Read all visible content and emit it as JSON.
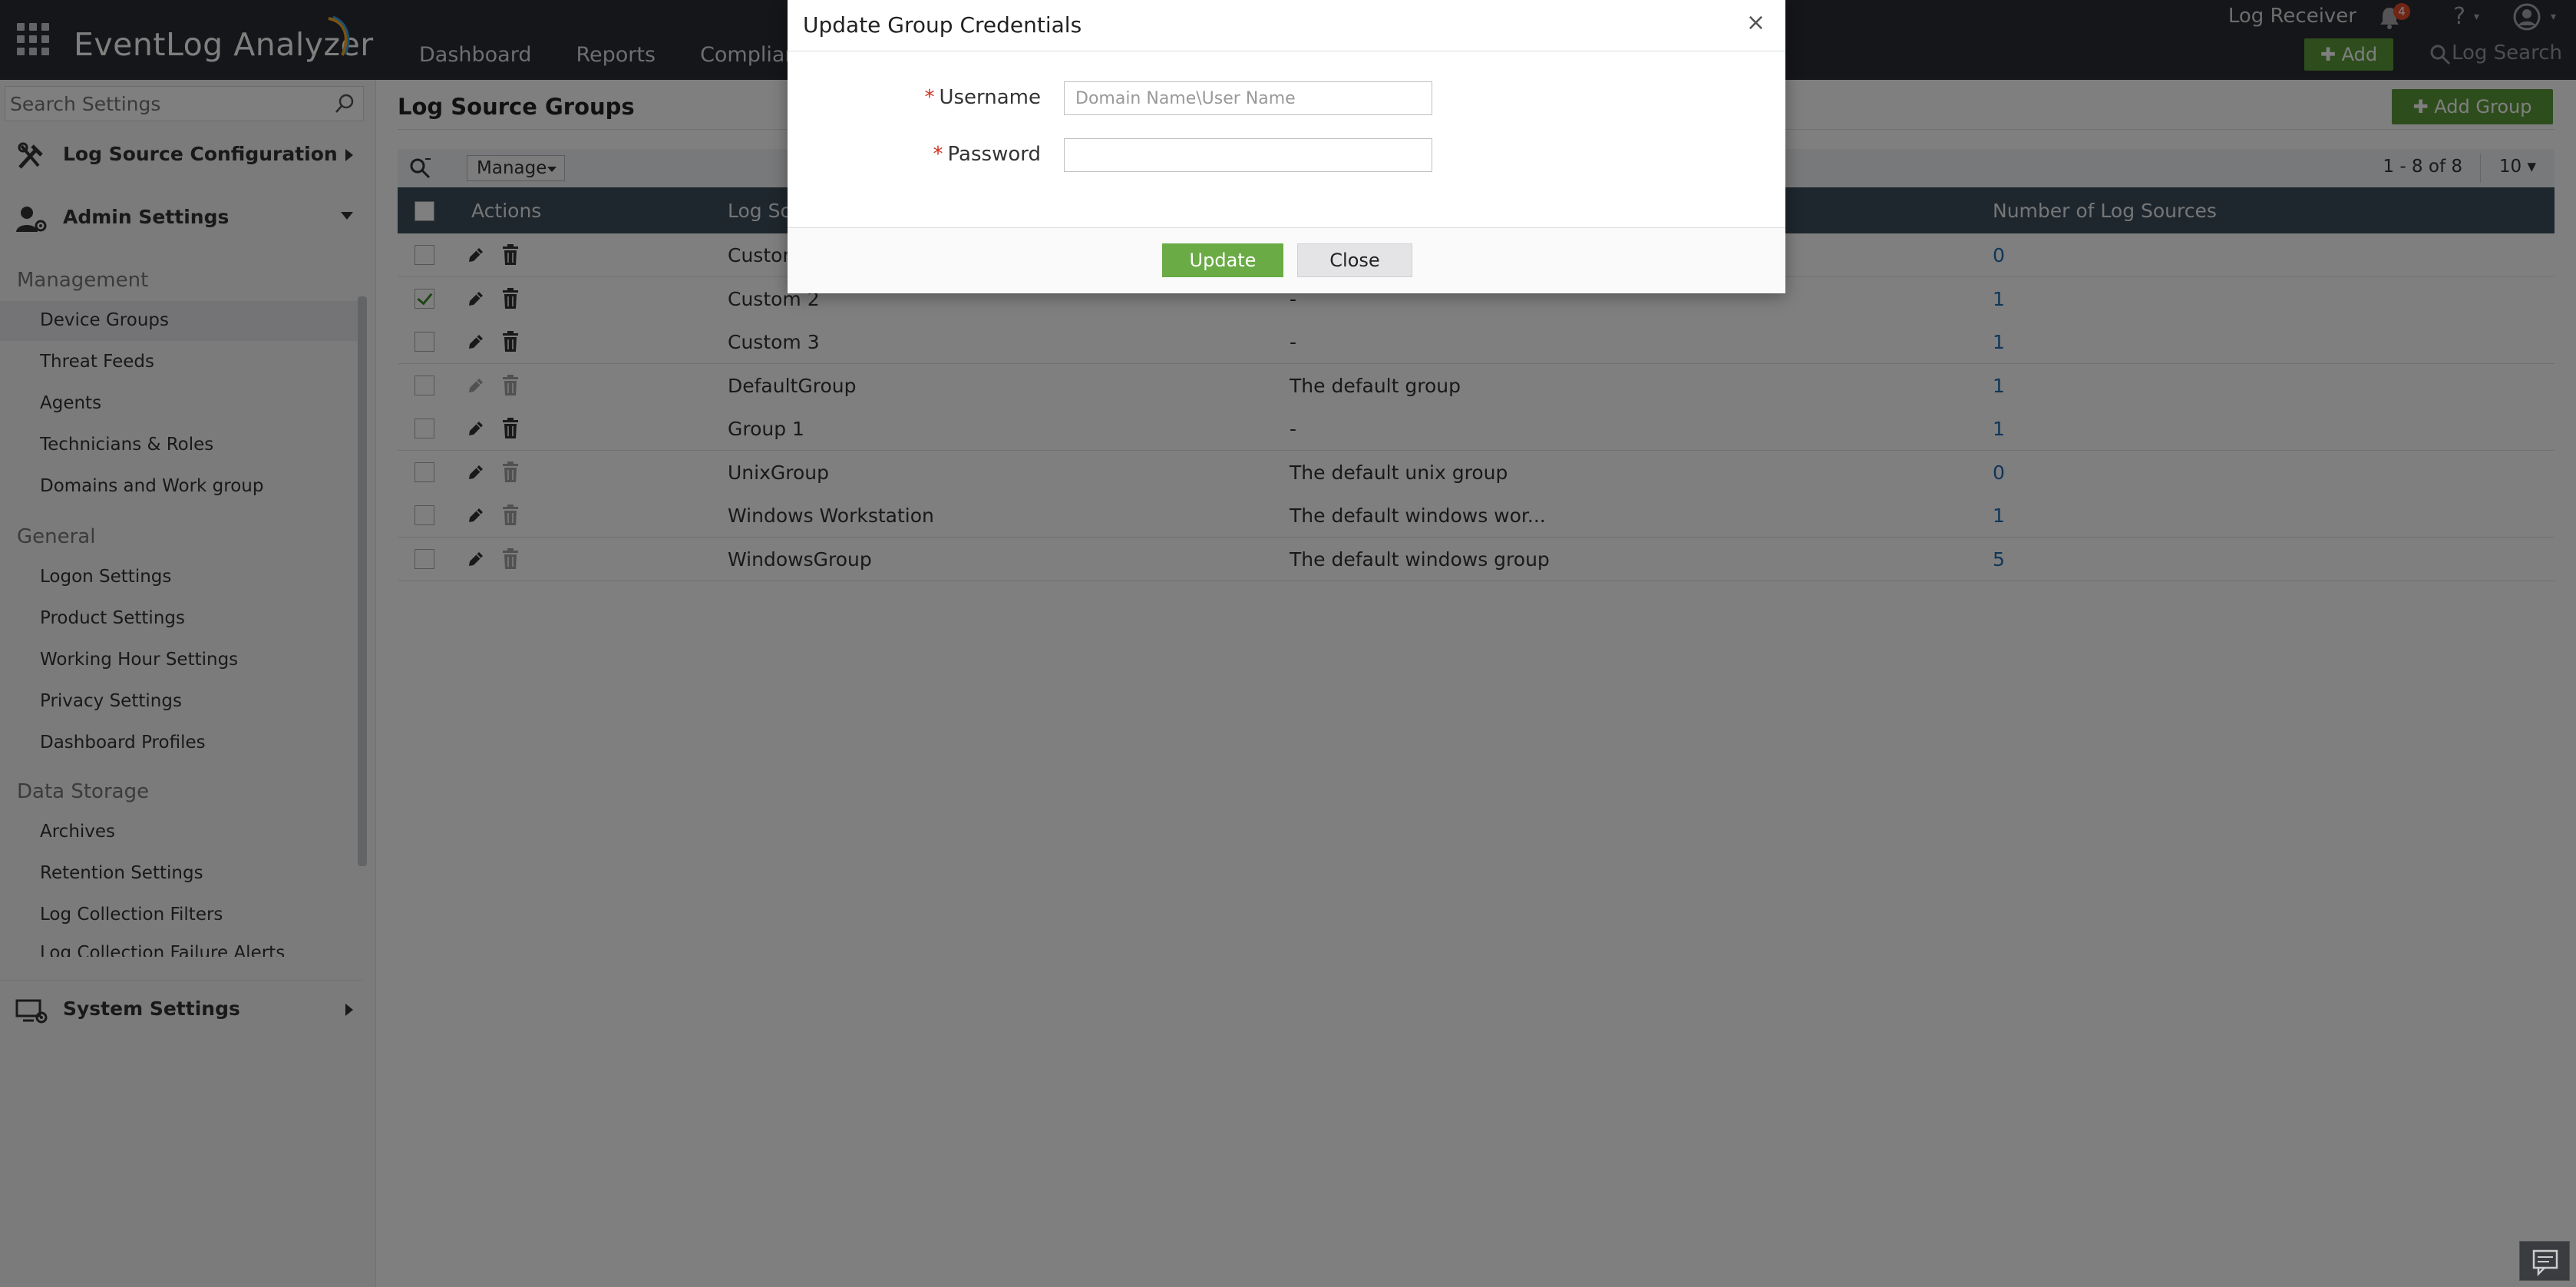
{
  "app": {
    "name": "EventLog Analyzer"
  },
  "nav": {
    "items": [
      "Dashboard",
      "Reports",
      "Compliance"
    ]
  },
  "header": {
    "log_receiver": "Log Receiver",
    "notification_count": "4",
    "help": "?",
    "add_label": "Add",
    "log_search_label": "Log Search"
  },
  "sidebar": {
    "search_placeholder": "Search Settings",
    "sections": {
      "log_source_configuration": "Log Source Configuration",
      "admin_settings": "Admin Settings",
      "system_settings": "System Settings"
    },
    "groups": {
      "management": "Management",
      "general": "General",
      "data_storage": "Data Storage"
    },
    "management_items": [
      "Device Groups",
      "Threat Feeds",
      "Agents",
      "Technicians & Roles",
      "Domains and Work group"
    ],
    "general_items": [
      "Logon Settings",
      "Product Settings",
      "Working Hour Settings",
      "Privacy Settings",
      "Dashboard Profiles"
    ],
    "data_storage_items": [
      "Archives",
      "Retention Settings",
      "Log Collection Filters",
      "Log Collection Failure Alerts"
    ],
    "active_item": "Device Groups"
  },
  "main": {
    "title": "Log Source Groups",
    "add_group_label": "Add Group",
    "manage_label": "Manage",
    "pagination": "1 - 8 of 8",
    "page_size": "10",
    "columns": {
      "actions": "Actions",
      "name": "Log Sou",
      "description": "",
      "count": "Number of Log Sources"
    },
    "rows": [
      {
        "name": "Custom",
        "description": "",
        "count": "0",
        "checked": false,
        "editable": true,
        "deletable": true
      },
      {
        "name": "Custom 2",
        "description": "-",
        "count": "1",
        "checked": true,
        "editable": true,
        "deletable": true
      },
      {
        "name": "Custom 3",
        "description": "-",
        "count": "1",
        "checked": false,
        "editable": true,
        "deletable": true
      },
      {
        "name": "DefaultGroup",
        "description": "The default group",
        "count": "1",
        "checked": false,
        "editable": false,
        "deletable": false
      },
      {
        "name": "Group 1",
        "description": "-",
        "count": "1",
        "checked": false,
        "editable": true,
        "deletable": true
      },
      {
        "name": "UnixGroup",
        "description": "The default unix group",
        "count": "0",
        "checked": false,
        "editable": true,
        "deletable": false
      },
      {
        "name": "Windows Workstation",
        "description": "The default windows wor...",
        "count": "1",
        "checked": false,
        "editable": true,
        "deletable": false
      },
      {
        "name": "WindowsGroup",
        "description": "The default windows group",
        "count": "5",
        "checked": false,
        "editable": true,
        "deletable": false
      }
    ]
  },
  "dialog": {
    "title": "Update Group Credentials",
    "close_symbol": "×",
    "required_marker": "*",
    "username_label": "Username",
    "username_placeholder": "Domain Name\\User Name",
    "username_value": "",
    "password_label": "Password",
    "password_value": "",
    "update_label": "Update",
    "close_label": "Close"
  },
  "colors": {
    "header_bg": "#2b2d32",
    "accent_green": "#5d9b3a",
    "table_header": "#3d4f5c",
    "link_blue": "#1f6db3"
  }
}
